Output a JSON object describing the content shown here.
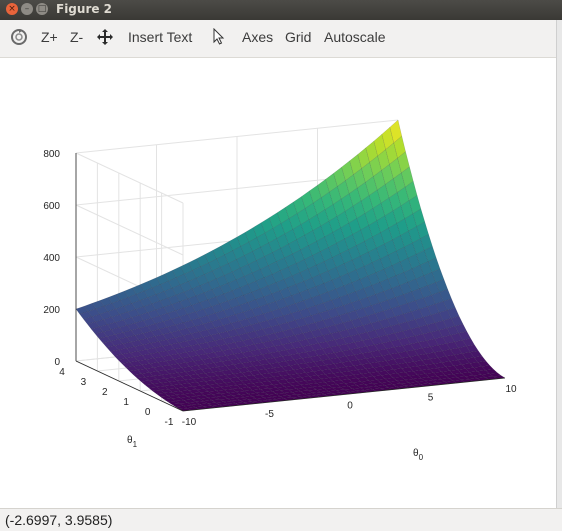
{
  "window": {
    "title": "Figure 2",
    "close_glyph": "×",
    "min_glyph": "–",
    "max_glyph": "□"
  },
  "toolbar": {
    "rotate_icon": "rotate-icon",
    "zoom_in_label": "Z+",
    "zoom_out_label": "Z-",
    "pan_icon": "pan-move-icon",
    "insert_text_label": "Insert Text",
    "select_icon": "select-pointer-icon",
    "axes_label": "Axes",
    "grid_label": "Grid",
    "autoscale_label": "Autoscale"
  },
  "status": {
    "coords": "(-2.6997, 3.9585)"
  },
  "chart_data": {
    "type": "surface",
    "title": "",
    "xlabel": "θ0",
    "ylabel": "θ1",
    "zlabel": "",
    "x_ticks": [
      "-10",
      "-5",
      "0",
      "5",
      "10"
    ],
    "y_ticks": [
      "-1",
      "0",
      "1",
      "2",
      "3",
      "4"
    ],
    "z_ticks": [
      "0",
      "200",
      "400",
      "600",
      "800"
    ],
    "xlim": [
      -10,
      10
    ],
    "ylim": [
      -1,
      4
    ],
    "zlim": [
      0,
      800
    ],
    "colormap": "viridis",
    "grid": true,
    "corner_values": [
      {
        "theta0": -10,
        "theta1": -1,
        "J": 0
      },
      {
        "theta0": 10,
        "theta1": -1,
        "J": 0
      },
      {
        "theta0": -10,
        "theta1": 4,
        "J": 200
      },
      {
        "theta0": 10,
        "theta1": 4,
        "J": 800
      }
    ]
  }
}
